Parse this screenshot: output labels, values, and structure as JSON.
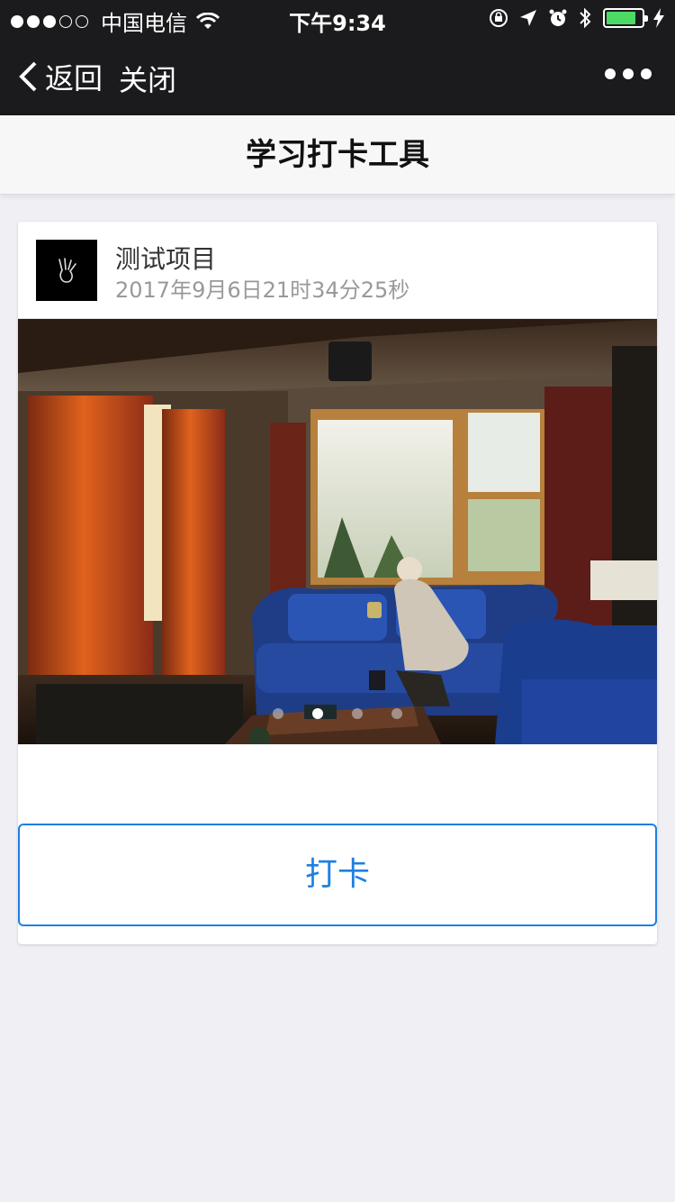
{
  "status_bar": {
    "carrier": "中国电信",
    "time": "下午9:34",
    "battery_level": 0.85,
    "battery_color": "#4cd964"
  },
  "nav": {
    "back_label": "返回",
    "close_label": "关闭",
    "more_icon": "more-dots-icon"
  },
  "header": {
    "title": "学习打卡工具"
  },
  "card": {
    "project_name": "测试项目",
    "timestamp": "2017年9月6日21时34分25秒",
    "carousel": {
      "total_slides": 4,
      "active_index": 1
    },
    "checkin_label": "打卡"
  },
  "colors": {
    "accent": "#1e80e0",
    "navbar_bg": "#1b1b1d",
    "page_bg": "#efeff4"
  }
}
